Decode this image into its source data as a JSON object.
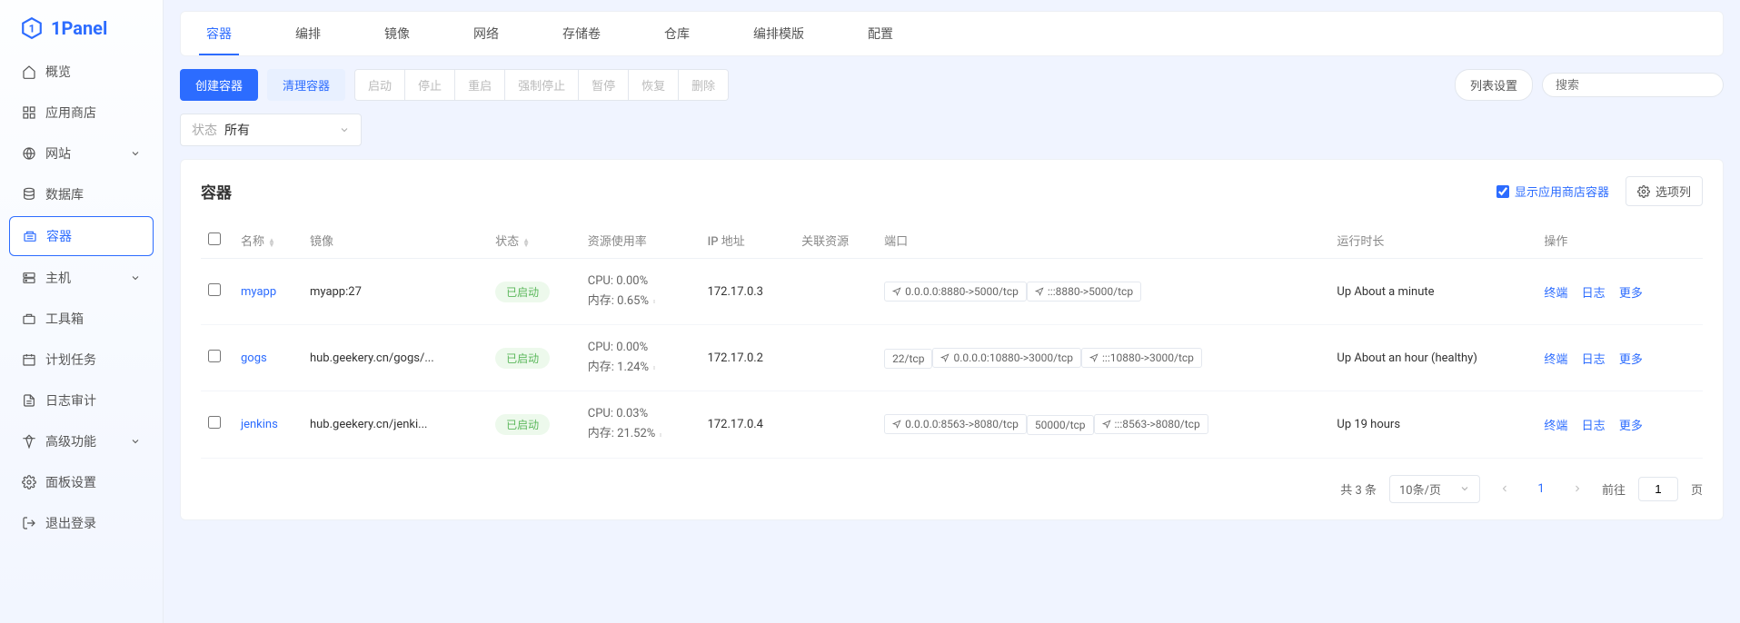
{
  "logo": "1Panel",
  "sidebar": {
    "items": [
      {
        "label": "概览"
      },
      {
        "label": "应用商店"
      },
      {
        "label": "网站"
      },
      {
        "label": "数据库"
      },
      {
        "label": "容器"
      },
      {
        "label": "主机"
      },
      {
        "label": "工具箱"
      },
      {
        "label": "计划任务"
      },
      {
        "label": "日志审计"
      },
      {
        "label": "高级功能"
      },
      {
        "label": "面板设置"
      },
      {
        "label": "退出登录"
      }
    ]
  },
  "tabs": [
    "容器",
    "编排",
    "镜像",
    "网络",
    "存储卷",
    "仓库",
    "编排模版",
    "配置"
  ],
  "toolbar": {
    "create": "创建容器",
    "clean": "清理容器",
    "ops": [
      "启动",
      "停止",
      "重启",
      "强制停止",
      "暂停",
      "恢复",
      "删除"
    ],
    "list_settings": "列表设置",
    "search_placeholder": "搜索"
  },
  "filter": {
    "label": "状态",
    "value": "所有"
  },
  "card": {
    "title": "容器",
    "show_app_label": "显示应用商店容器",
    "columns_btn": "选项列",
    "columns": [
      "",
      "名称",
      "镜像",
      "状态",
      "资源使用率",
      "IP 地址",
      "关联资源",
      "端口",
      "运行时长",
      "操作"
    ],
    "rows": [
      {
        "name": "myapp",
        "image": "myapp:27",
        "status": "已启动",
        "cpu": "CPU: 0.00%",
        "mem": "内存: 0.65%",
        "ip": "172.17.0.3",
        "related": "",
        "ports": [
          "0.0.0.0:8880->5000/tcp",
          ":::8880->5000/tcp"
        ],
        "uptime": "Up About a minute"
      },
      {
        "name": "gogs",
        "image": "hub.geekery.cn/gogs/...",
        "status": "已启动",
        "cpu": "CPU: 0.00%",
        "mem": "内存: 1.24%",
        "ip": "172.17.0.2",
        "related": "",
        "ports": [
          "22/tcp",
          "0.0.0.0:10880->3000/tcp",
          ":::10880->3000/tcp"
        ],
        "uptime": "Up About an hour (healthy)"
      },
      {
        "name": "jenkins",
        "image": "hub.geekery.cn/jenki...",
        "status": "已启动",
        "cpu": "CPU: 0.03%",
        "mem": "内存: 21.52%",
        "ip": "172.17.0.4",
        "related": "",
        "ports": [
          "0.0.0.0:8563->8080/tcp",
          "50000/tcp",
          ":::8563->8080/tcp"
        ],
        "uptime": "Up 19 hours"
      }
    ],
    "row_actions": {
      "terminal": "终端",
      "log": "日志",
      "more": "更多"
    }
  },
  "pagination": {
    "total": "共 3 条",
    "per_page": "10条/页",
    "current": "1",
    "goto_prefix": "前往",
    "goto_value": "1",
    "goto_suffix": "页"
  }
}
